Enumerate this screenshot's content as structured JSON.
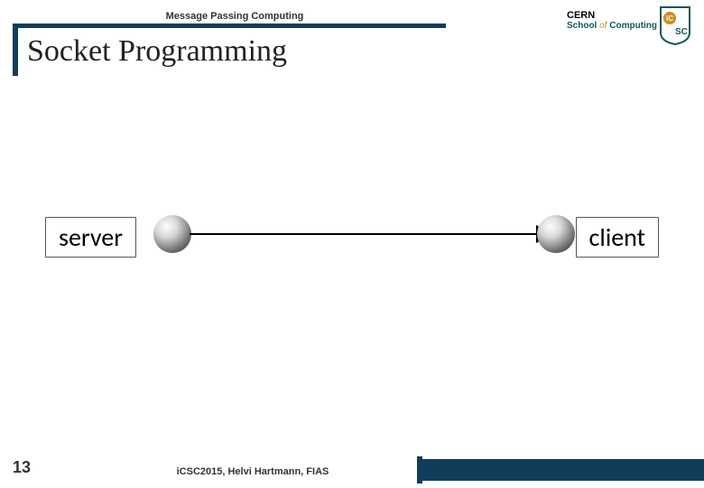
{
  "header": {
    "breadcrumb": "Message Passing Computing",
    "logo": {
      "line1": "CERN",
      "line2_school": "School",
      "line2_of": "of",
      "line2_comp": "Computing",
      "icon_name": "csc-shield-icon"
    }
  },
  "title": "Socket Programming",
  "diagram": {
    "left_box_label": "server",
    "right_box_label": "client",
    "left_node": "server-node-ball",
    "right_node": "client-node-ball",
    "arrow": "connection-arrow"
  },
  "footer": {
    "page_number": "13",
    "credit": "iCSC2015, Helvi Hartmann, FIAS"
  },
  "colors": {
    "frame": "#0f3e5a",
    "accent_school": "#0b5a58",
    "accent_of": "#d08c1c"
  }
}
